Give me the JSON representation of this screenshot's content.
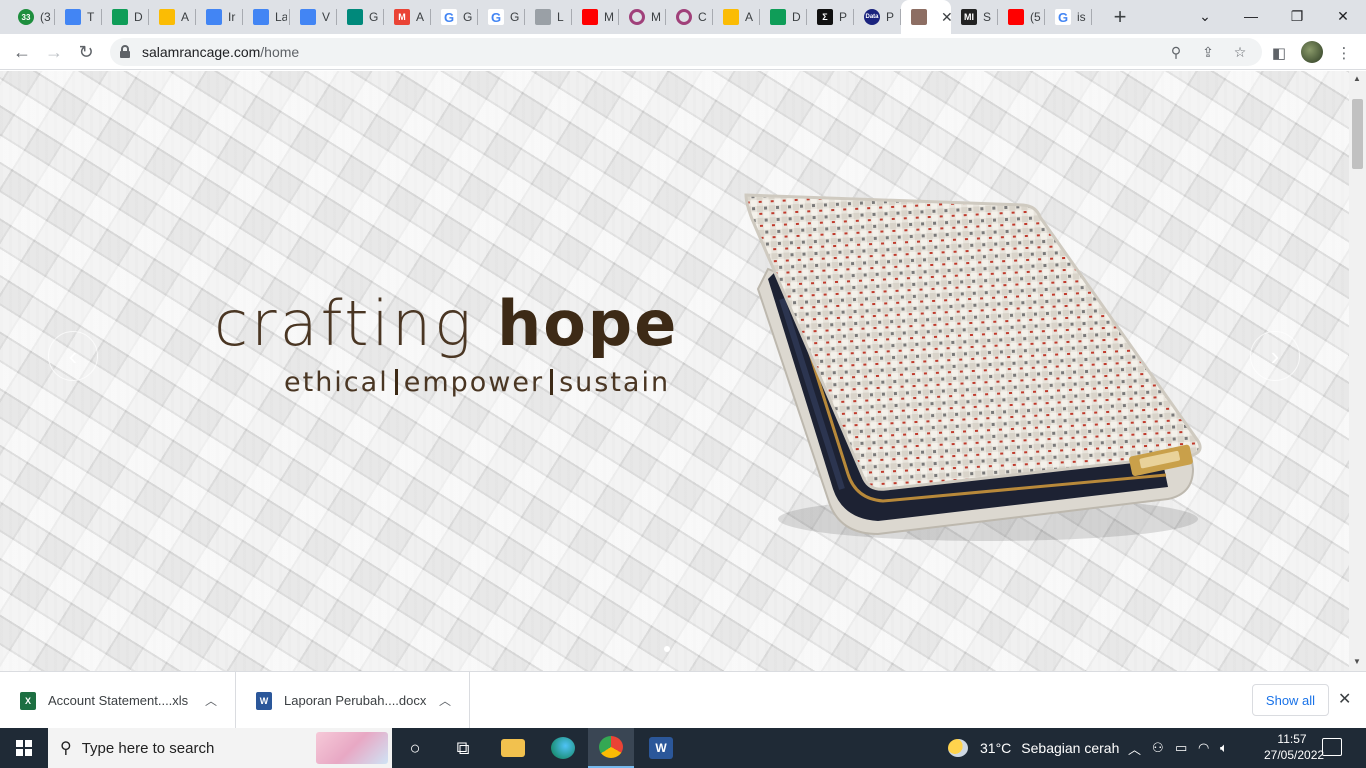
{
  "browser": {
    "tabs": [
      {
        "title": "(3",
        "favicon": "badge",
        "fav_text": "33",
        "color": "#1e8e3e"
      },
      {
        "title": "T",
        "favicon": "docs",
        "fav_text": "",
        "color": "#4285f4"
      },
      {
        "title": "D",
        "favicon": "sheets",
        "fav_text": "",
        "color": "#0f9d58"
      },
      {
        "title": "A",
        "favicon": "drive",
        "fav_text": "",
        "color": "#fbbc04"
      },
      {
        "title": "Ir",
        "favicon": "docs",
        "fav_text": "",
        "color": "#4285f4"
      },
      {
        "title": "La",
        "favicon": "docs",
        "fav_text": "",
        "color": "#4285f4"
      },
      {
        "title": "V",
        "favicon": "docs",
        "fav_text": "",
        "color": "#4285f4"
      },
      {
        "title": "G",
        "favicon": "meet",
        "fav_text": "",
        "color": "#00897b"
      },
      {
        "title": "A",
        "favicon": "gmail",
        "fav_text": "M",
        "color": "#ea4335"
      },
      {
        "title": "G",
        "favicon": "google",
        "fav_text": "G",
        "color": "#4285f4"
      },
      {
        "title": "G",
        "favicon": "google",
        "fav_text": "G",
        "color": "#4285f4"
      },
      {
        "title": "L",
        "favicon": "logo",
        "fav_text": "",
        "color": "#9aa0a6"
      },
      {
        "title": "M",
        "favicon": "youtube",
        "fav_text": "",
        "color": "#ff0000"
      },
      {
        "title": "M",
        "favicon": "ring",
        "fav_text": "",
        "color": "#a0407a"
      },
      {
        "title": "C",
        "favicon": "ring",
        "fav_text": "",
        "color": "#a0407a"
      },
      {
        "title": "A",
        "favicon": "drive",
        "fav_text": "",
        "color": "#fbbc04"
      },
      {
        "title": "D",
        "favicon": "sheets",
        "fav_text": "",
        "color": "#0f9d58"
      },
      {
        "title": "P",
        "favicon": "sigma",
        "fav_text": "Σ",
        "color": "#111111"
      },
      {
        "title": "P",
        "favicon": "data",
        "fav_text": "Data",
        "color": "#1a237e"
      },
      {
        "title": "",
        "favicon": "site",
        "fav_text": "",
        "color": "#8d6e63",
        "active": true
      },
      {
        "title": "S",
        "favicon": "mi",
        "fav_text": "MI",
        "color": "#222222"
      },
      {
        "title": "(5",
        "favicon": "youtube",
        "fav_text": "",
        "color": "#ff0000"
      },
      {
        "title": "is",
        "favicon": "google",
        "fav_text": "G",
        "color": "#4285f4"
      }
    ],
    "new_tab_label": "+",
    "url_host": "salamrancage.com",
    "url_path": "/home"
  },
  "hero": {
    "headline_light": "crafting",
    "headline_bold": "hope",
    "tagline": [
      "ethical",
      "empower",
      "sustain"
    ],
    "prev_glyph": "‹",
    "next_glyph": "›",
    "slide_index": 1
  },
  "downloads": {
    "items": [
      {
        "name": "Account Statement....xls",
        "type": "excel",
        "glyph": "X",
        "color": "#1d6f42"
      },
      {
        "name": "Laporan Perubah....docx",
        "type": "word",
        "glyph": "W",
        "color": "#2b579a"
      }
    ],
    "show_all_label": "Show all"
  },
  "taskbar": {
    "search_placeholder": "Type here to search",
    "weather_temp": "31°C",
    "weather_desc": "Sebagian cerah",
    "time": "11:57",
    "date": "27/05/2022"
  }
}
